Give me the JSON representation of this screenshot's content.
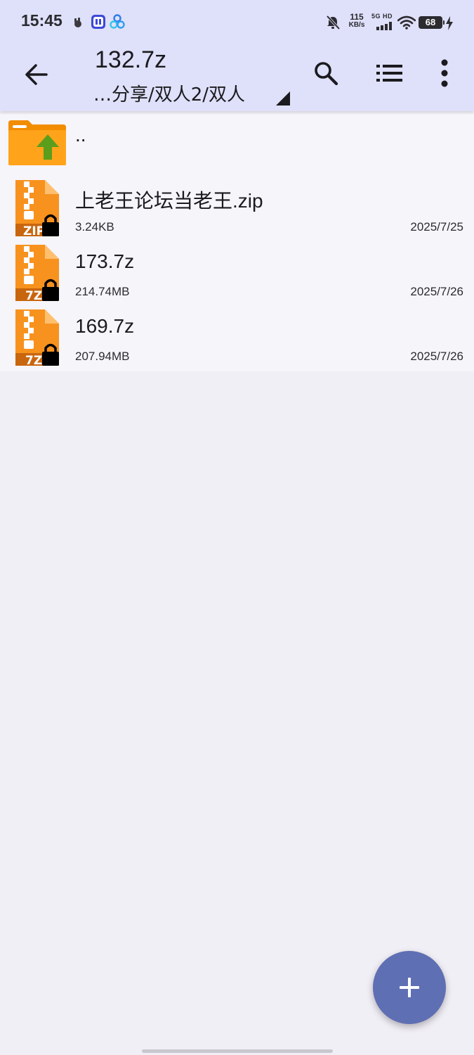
{
  "status_bar": {
    "time": "15:45",
    "net_speed_value": "115",
    "net_speed_unit": "KB/s",
    "net_type": "5G HD",
    "battery": "68",
    "icons": [
      "app-notification-icon",
      "tieba-icon",
      "cloud-share-icon",
      "mute-bell-icon",
      "signal-icon",
      "wifi-icon",
      "charging-icon"
    ]
  },
  "toolbar": {
    "title": "132.7z",
    "path": "…分享/双人2/双人",
    "icons": [
      "back-arrow-icon",
      "search-icon",
      "list-view-icon",
      "more-options-icon"
    ]
  },
  "file_list": {
    "parent": {
      "name": ".."
    },
    "files": [
      {
        "name": "上老王论坛当老王.zip",
        "size": "3.24KB",
        "date": "2025/7/25",
        "icon_label": "ZIP",
        "locked": true
      },
      {
        "name": "173.7z",
        "size": "214.74MB",
        "date": "2025/7/26",
        "icon_label": "7Z",
        "locked": true
      },
      {
        "name": "169.7z",
        "size": "207.94MB",
        "date": "2025/7/26",
        "icon_label": "7Z",
        "locked": true
      }
    ]
  },
  "fab": {
    "icon": "plus-icon"
  },
  "colors": {
    "header_bg": "#dfe0f9",
    "page_bg": "#f1eff6",
    "list_bg": "#f6f5fa",
    "archive_orange": "#f7921e",
    "archive_dark": "#c8660f",
    "folder_orange": "#ffa31a",
    "folder_arrow_green": "#5a9e1c",
    "fab_color": "#5f6fb4"
  }
}
